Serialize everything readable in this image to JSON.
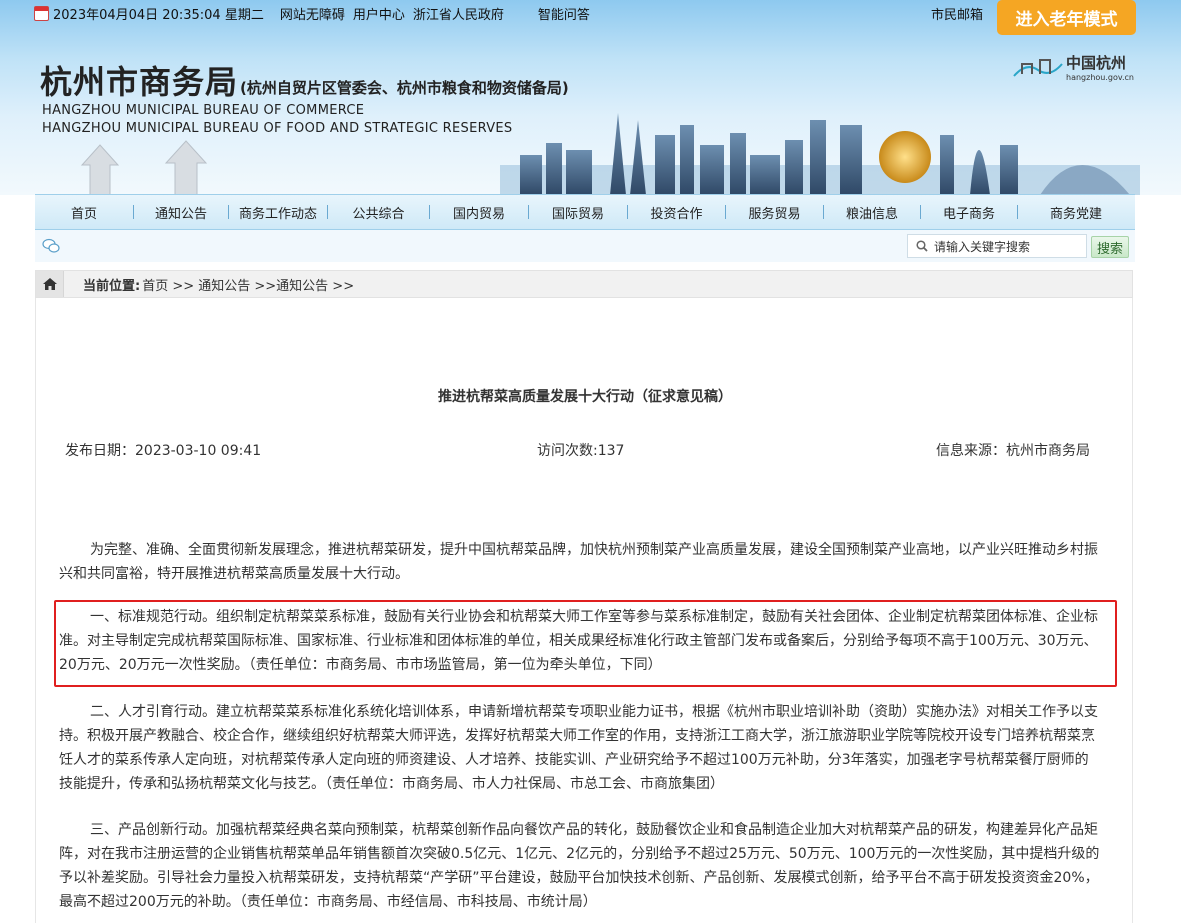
{
  "topbar": {
    "datetime": "2023年04月04日 20:35:04 星期二",
    "links": [
      "网站无障碍",
      "用户中心",
      "浙江省人民政府",
      "智能问答"
    ],
    "mailbox": "市民邮箱",
    "elder_mode": "进入老年模式"
  },
  "header": {
    "title": "杭州市商务局",
    "subtitle": "(杭州自贸片区管委会、杭州市粮食和物资储备局)",
    "en_line1": "HANGZHOU MUNICIPAL BUREAU OF COMMERCE",
    "en_line2": "HANGZHOU  MUNICIPAL BUREAU OF FOOD AND STRATEGIC RESERVES",
    "portal_name": "中国杭州",
    "portal_url": "hangzhou.gov.cn"
  },
  "nav": {
    "items": [
      "首页",
      "通知公告",
      "商务工作动态",
      "公共综合",
      "国内贸易",
      "国际贸易",
      "投资合作",
      "服务贸易",
      "粮油信息",
      "电子商务",
      "商务党建"
    ]
  },
  "search": {
    "placeholder": "请输入关键字搜索",
    "button": "搜索"
  },
  "breadcrumb": {
    "label": "当前位置:",
    "path": "首页 >> 通知公告 >>通知公告 >>"
  },
  "article": {
    "title": "推进杭帮菜高质量发展十大行动（征求意见稿）",
    "publish_date": "发布日期：2023-03-10 09:41",
    "visits": "访问次数:137",
    "source": "信息来源：杭州市商务局",
    "paragraphs": [
      "为完整、准确、全面贯彻新发展理念，推进杭帮菜研发，提升中国杭帮菜品牌，加快杭州预制菜产业高质量发展，建设全国预制菜产业高地，以产业兴旺推动乡村振兴和共同富裕，特开展推进杭帮菜高质量发展十大行动。",
      "一、标准规范行动。组织制定杭帮菜菜系标准，鼓励有关行业协会和杭帮菜大师工作室等参与菜系标准制定，鼓励有关社会团体、企业制定杭帮菜团体标准、企业标准。对主导制定完成杭帮菜国际标准、国家标准、行业标准和团体标准的单位，相关成果经标准化行政主管部门发布或备案后，分别给予每项不高于100万元、30万元、20万元、20万元一次性奖励。（责任单位：市商务局、市市场监管局，第一位为牵头单位，下同）",
      "二、人才引育行动。建立杭帮菜菜系标准化系统化培训体系，申请新增杭帮菜专项职业能力证书，根据《杭州市职业培训补助（资助）实施办法》对相关工作予以支持。积极开展产教融合、校企合作，继续组织好杭帮菜大师评选，发挥好杭帮菜大师工作室的作用，支持浙江工商大学，浙江旅游职业学院等院校开设专门培养杭帮菜烹饪人才的菜系传承人定向班，对杭帮菜传承人定向班的师资建设、人才培养、技能实训、产业研究给予不超过100万元补助，分3年落实，加强老字号杭帮菜餐厅厨师的技能提升，传承和弘扬杭帮菜文化与技艺。（责任单位：市商务局、市人力社保局、市总工会、市商旅集团）",
      "三、产品创新行动。加强杭帮菜经典名菜向预制菜，杭帮菜创新作品向餐饮产品的转化，鼓励餐饮企业和食品制造企业加大对杭帮菜产品的研发，构建差异化产品矩阵，对在我市注册运营的企业销售杭帮菜单品年销售额首次突破0.5亿元、1亿元、2亿元的，分别给予不超过25万元、50万元、100万元的一次性奖励，其中提档升级的予以补差奖励。引导社会力量投入杭帮菜研发，支持杭帮菜“产学研”平台建设，鼓励平台加快技术创新、产品创新、发展模式创新，给予平台不高于研发投资资金20%，最高不超过200万元的补助。（责任单位：市商务局、市经信局、市科技局、市统计局）"
    ]
  }
}
